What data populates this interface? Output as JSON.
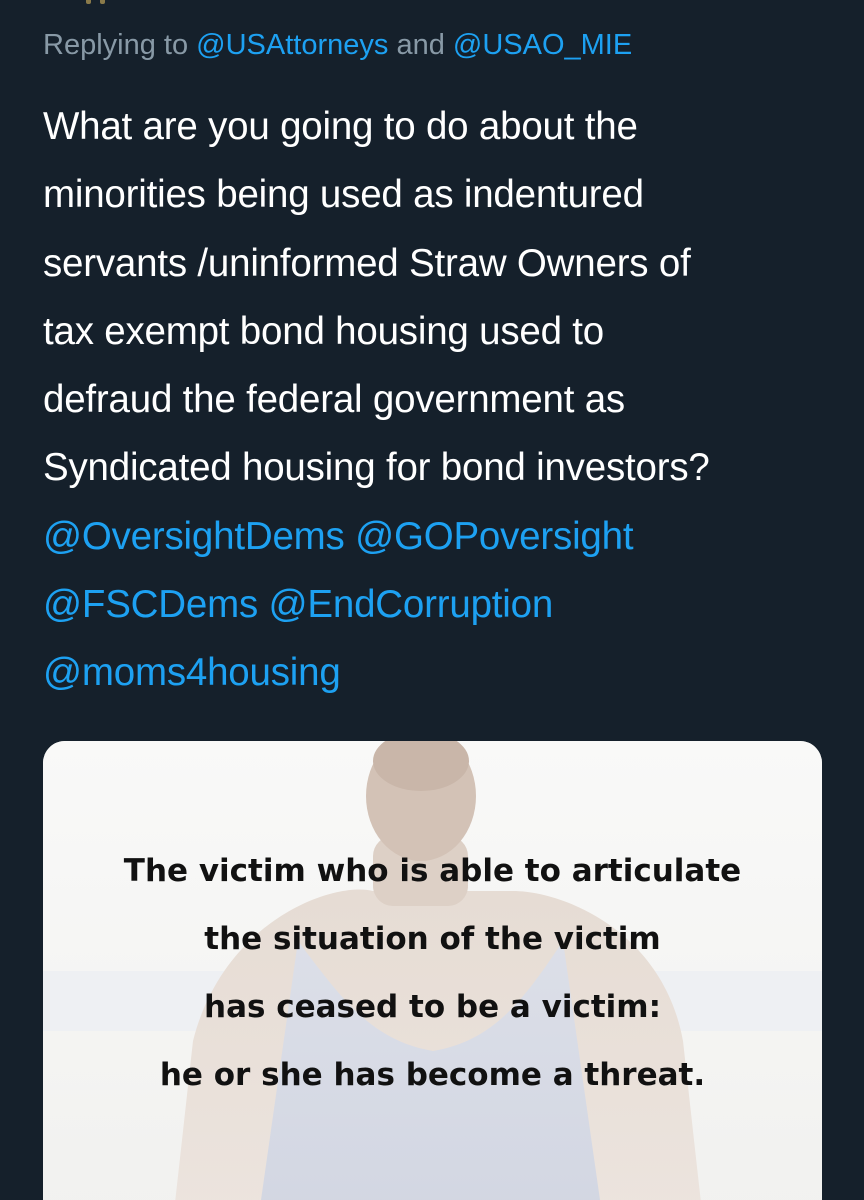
{
  "tweet": {
    "reply_prefix": "Replying to ",
    "reply_mention_1": "@USAttorneys",
    "reply_joiner": " and ",
    "reply_mention_2": "@USAO_MIE",
    "body_lines": [
      "What are you going to do about the",
      "minorities being used as indentured",
      "servants /uninformed Straw Owners of",
      "tax exempt bond housing used to",
      "defraud the federal government as",
      "Syndicated housing for bond investors?"
    ],
    "mention_lines": [
      "@OversightDems @GOPoversight",
      "@FSCDems @EndCorruption",
      "@moms4housing"
    ]
  },
  "media": {
    "caption_lines": [
      "The victim who is able to articulate",
      "the situation of the victim",
      "has ceased to be a victim:",
      "he or she has become a threat."
    ]
  },
  "colors": {
    "background": "#15202b",
    "text": "#ffffff",
    "secondary_text": "#8899a6",
    "link": "#1da1f2"
  }
}
